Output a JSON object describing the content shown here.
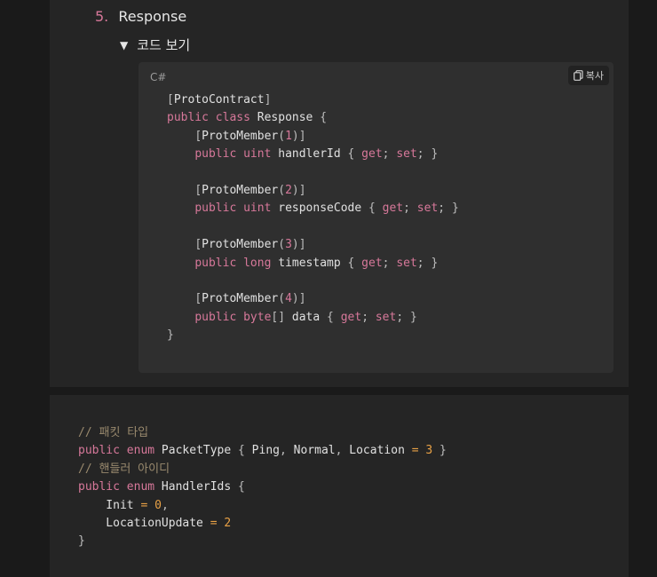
{
  "list": {
    "number": "5.",
    "title": "Response"
  },
  "toggle": {
    "label": "코드 보기"
  },
  "codebox": {
    "language": "C#",
    "copy_label": "복사"
  },
  "code_top": [
    "[ProtoContract]",
    "public class Response {",
    "    [ProtoMember(1)]",
    "    public uint handlerId { get; set; }",
    "",
    "    [ProtoMember(2)]",
    "    public uint responseCode { get; set; }",
    "",
    "    [ProtoMember(3)]",
    "    public long timestamp { get; set; }",
    "",
    "    [ProtoMember(4)]",
    "    public byte[] data { get; set; }",
    "}"
  ],
  "code_bottom": [
    "// 패킷 타입",
    "public enum PacketType { Ping, Normal, Location = 3 }",
    "// 핸들러 아이디",
    "public enum HandlerIds {",
    "    Init = 0,",
    "    LocationUpdate = 2",
    "}"
  ]
}
